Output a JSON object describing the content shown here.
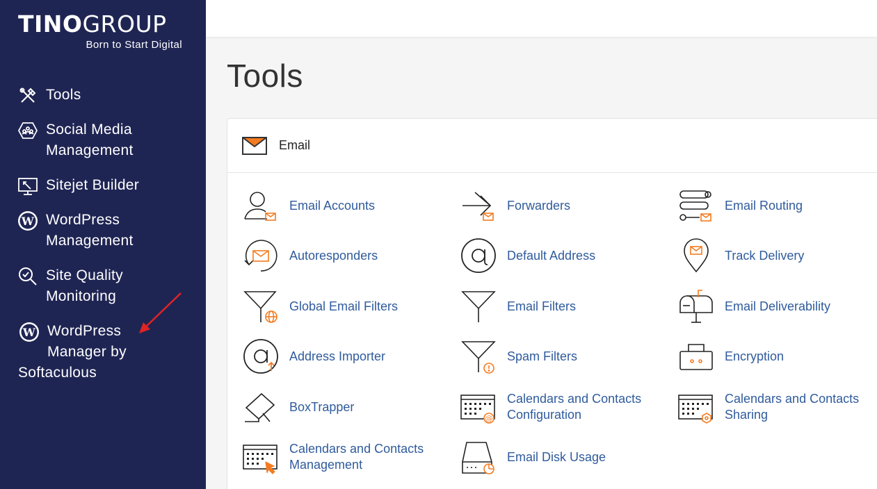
{
  "brand": {
    "name_part1": "TINO",
    "name_part2": "GROUP",
    "tagline": "Born to Start Digital"
  },
  "sidebar": {
    "items": [
      {
        "label": "Tools",
        "icon": "tools-icon"
      },
      {
        "label": "Social Media\nManagement",
        "icon": "social-media-icon"
      },
      {
        "label": "Sitejet Builder",
        "icon": "sitejet-icon"
      },
      {
        "label": "WordPress\nManagement",
        "icon": "wordpress-icon"
      },
      {
        "label": "Site Quality\nMonitoring",
        "icon": "site-quality-icon"
      },
      {
        "label": "WordPress\nManager by",
        "label_tail": "Softaculous",
        "icon": "wordpress-icon"
      }
    ]
  },
  "page": {
    "title": "Tools"
  },
  "email_section": {
    "title": "Email",
    "tools": [
      {
        "label": "Email Accounts",
        "icon": "email-accounts-icon"
      },
      {
        "label": "Forwarders",
        "icon": "forwarders-icon"
      },
      {
        "label": "Email Routing",
        "icon": "email-routing-icon"
      },
      {
        "label": "Autoresponders",
        "icon": "autoresponders-icon"
      },
      {
        "label": "Default Address",
        "icon": "at-sign-icon"
      },
      {
        "label": "Track Delivery",
        "icon": "track-delivery-icon"
      },
      {
        "label": "Global Email Filters",
        "icon": "global-filter-icon"
      },
      {
        "label": "Email Filters",
        "icon": "filter-icon"
      },
      {
        "label": "Email Deliverability",
        "icon": "mailbox-icon"
      },
      {
        "label": "Address Importer",
        "icon": "address-importer-icon"
      },
      {
        "label": "Spam Filters",
        "icon": "spam-filter-icon"
      },
      {
        "label": "Encryption",
        "icon": "encryption-icon"
      },
      {
        "label": "BoxTrapper",
        "icon": "boxtrapper-icon"
      },
      {
        "label": "Calendars and Contacts\nConfiguration",
        "icon": "calendar-config-icon"
      },
      {
        "label": "Calendars and Contacts\nSharing",
        "icon": "calendar-sharing-icon"
      },
      {
        "label": "Calendars and Contacts\nManagement",
        "icon": "calendar-management-icon"
      },
      {
        "label": "Email Disk Usage",
        "icon": "disk-usage-icon"
      }
    ]
  },
  "colors": {
    "sidebar_bg": "#1f2553",
    "link": "#2f5b9c",
    "accent": "#f47b20",
    "annotation_arrow": "#e02424"
  }
}
